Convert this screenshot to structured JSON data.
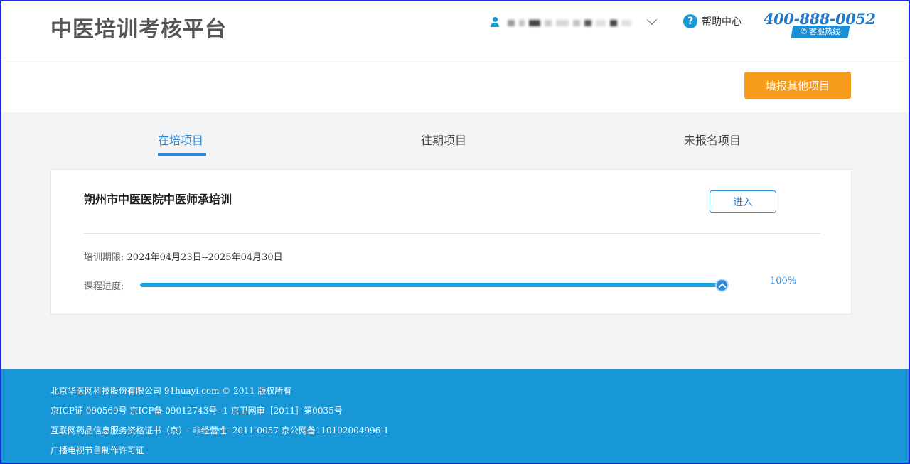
{
  "header": {
    "brand": "中医培训考核平台",
    "user_icon": "user-icon",
    "user_menu_icon": "chevron-down-icon",
    "help_icon": "question-icon",
    "help_label": "帮助中心",
    "hotline_number": "400-888-0052",
    "hotline_label": "客服热线"
  },
  "actions": {
    "fill_other_label": "填报其他项目"
  },
  "tabs": [
    {
      "label": "在培项目",
      "active": true
    },
    {
      "label": "往期项目",
      "active": false
    },
    {
      "label": "未报名项目",
      "active": false
    }
  ],
  "card": {
    "title": "朔州市中医医院中医师承培训",
    "enter_label": "进入",
    "period_label": "培训期限:",
    "period_value": "2024年04月23日--2025年04月30日",
    "progress_label": "课程进度:",
    "progress_value": 100,
    "progress_text": "100%"
  },
  "footer": {
    "lines": [
      "北京华医网科技股份有限公司 91huayi.com © 2011 版权所有",
      "京ICP证 090569号 京ICP备 09012743号-  1 京卫网审［2011］第0035号",
      "互联网药品信息服务资格证书（京）-  非经营性-   2011-0057 京公网备110102004996-1",
      "广播电视节目制作许可证"
    ]
  },
  "colors": {
    "accent": "#2f88d8",
    "orange": "#f79b1a",
    "footer": "#1797d6",
    "progress": "#1aa0e0"
  }
}
